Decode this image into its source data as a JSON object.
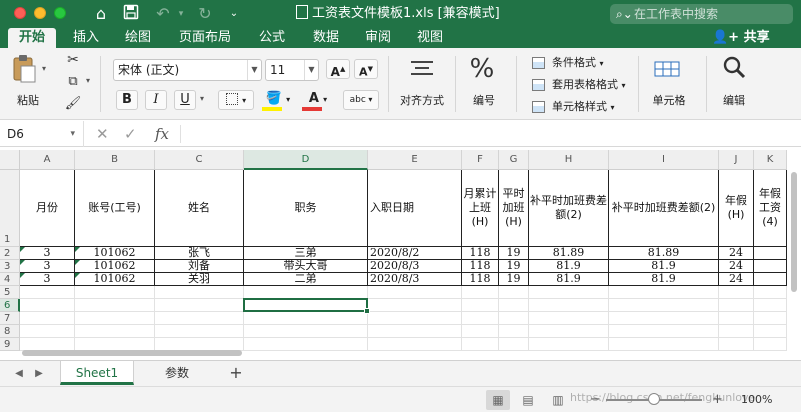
{
  "window": {
    "title": "工资表文件模板1.xls  [兼容模式]",
    "search_placeholder": "在工作表中搜索"
  },
  "tabs": [
    {
      "label": "开始",
      "active": true
    },
    {
      "label": "插入"
    },
    {
      "label": "绘图"
    },
    {
      "label": "页面布局"
    },
    {
      "label": "公式"
    },
    {
      "label": "数据"
    },
    {
      "label": "审阅"
    },
    {
      "label": "视图"
    }
  ],
  "share_label": "共享",
  "ribbon": {
    "paste_label": "粘贴",
    "font_name": "宋体 (正文)",
    "font_size": "11",
    "bold": "B",
    "italic": "I",
    "underline": "U",
    "font_color_letter": "A",
    "fill_color": "#FFF100",
    "font_color": "#E53935",
    "phonetic": "abc",
    "align_label": "对齐方式",
    "number_label": "编号",
    "number_icon": "%",
    "conditional_format": "条件格式",
    "table_format": "套用表格格式",
    "cell_style": "单元格样式",
    "cells_label": "单元格",
    "edit_label": "编辑"
  },
  "formula_bar": {
    "name_box": "D6",
    "fx": "fx"
  },
  "grid": {
    "columns": [
      "A",
      "B",
      "C",
      "D",
      "E",
      "F",
      "G",
      "H",
      "I",
      "J",
      "K"
    ],
    "selected_column": "D",
    "rows": [
      "1",
      "2",
      "3",
      "4",
      "5",
      "6",
      "7",
      "8",
      "9"
    ],
    "selected_row": "6",
    "header_cells": [
      "月份",
      "账号(工号)",
      "姓名",
      "职务",
      "入职日期",
      "月累计上班(H)",
      "平时加班(H)",
      "补平时加班费差额(2)",
      "补平时加班费差额(2)",
      "年假(H)",
      "年假工资(4)"
    ],
    "data_rows": [
      [
        "3",
        "101062",
        "张飞",
        "三弟",
        "2020/8/2",
        "118",
        "19",
        "81.89",
        "81.89",
        "24",
        ""
      ],
      [
        "3",
        "101062",
        "刘备",
        "带头大哥",
        "2020/8/3",
        "118",
        "19",
        "81.9",
        "81.9",
        "24",
        ""
      ],
      [
        "3",
        "101062",
        "关羽",
        "二弟",
        "2020/8/3",
        "118",
        "19",
        "81.9",
        "81.9",
        "24",
        ""
      ]
    ]
  },
  "sheets": [
    {
      "label": "Sheet1",
      "active": true
    },
    {
      "label": "参数"
    }
  ],
  "status": {
    "watermark": "https://blog.csdn.net/fengkunlove",
    "zoom": "100%",
    "zoom_level": 1.0
  },
  "colors": {
    "accent": "#217346"
  }
}
